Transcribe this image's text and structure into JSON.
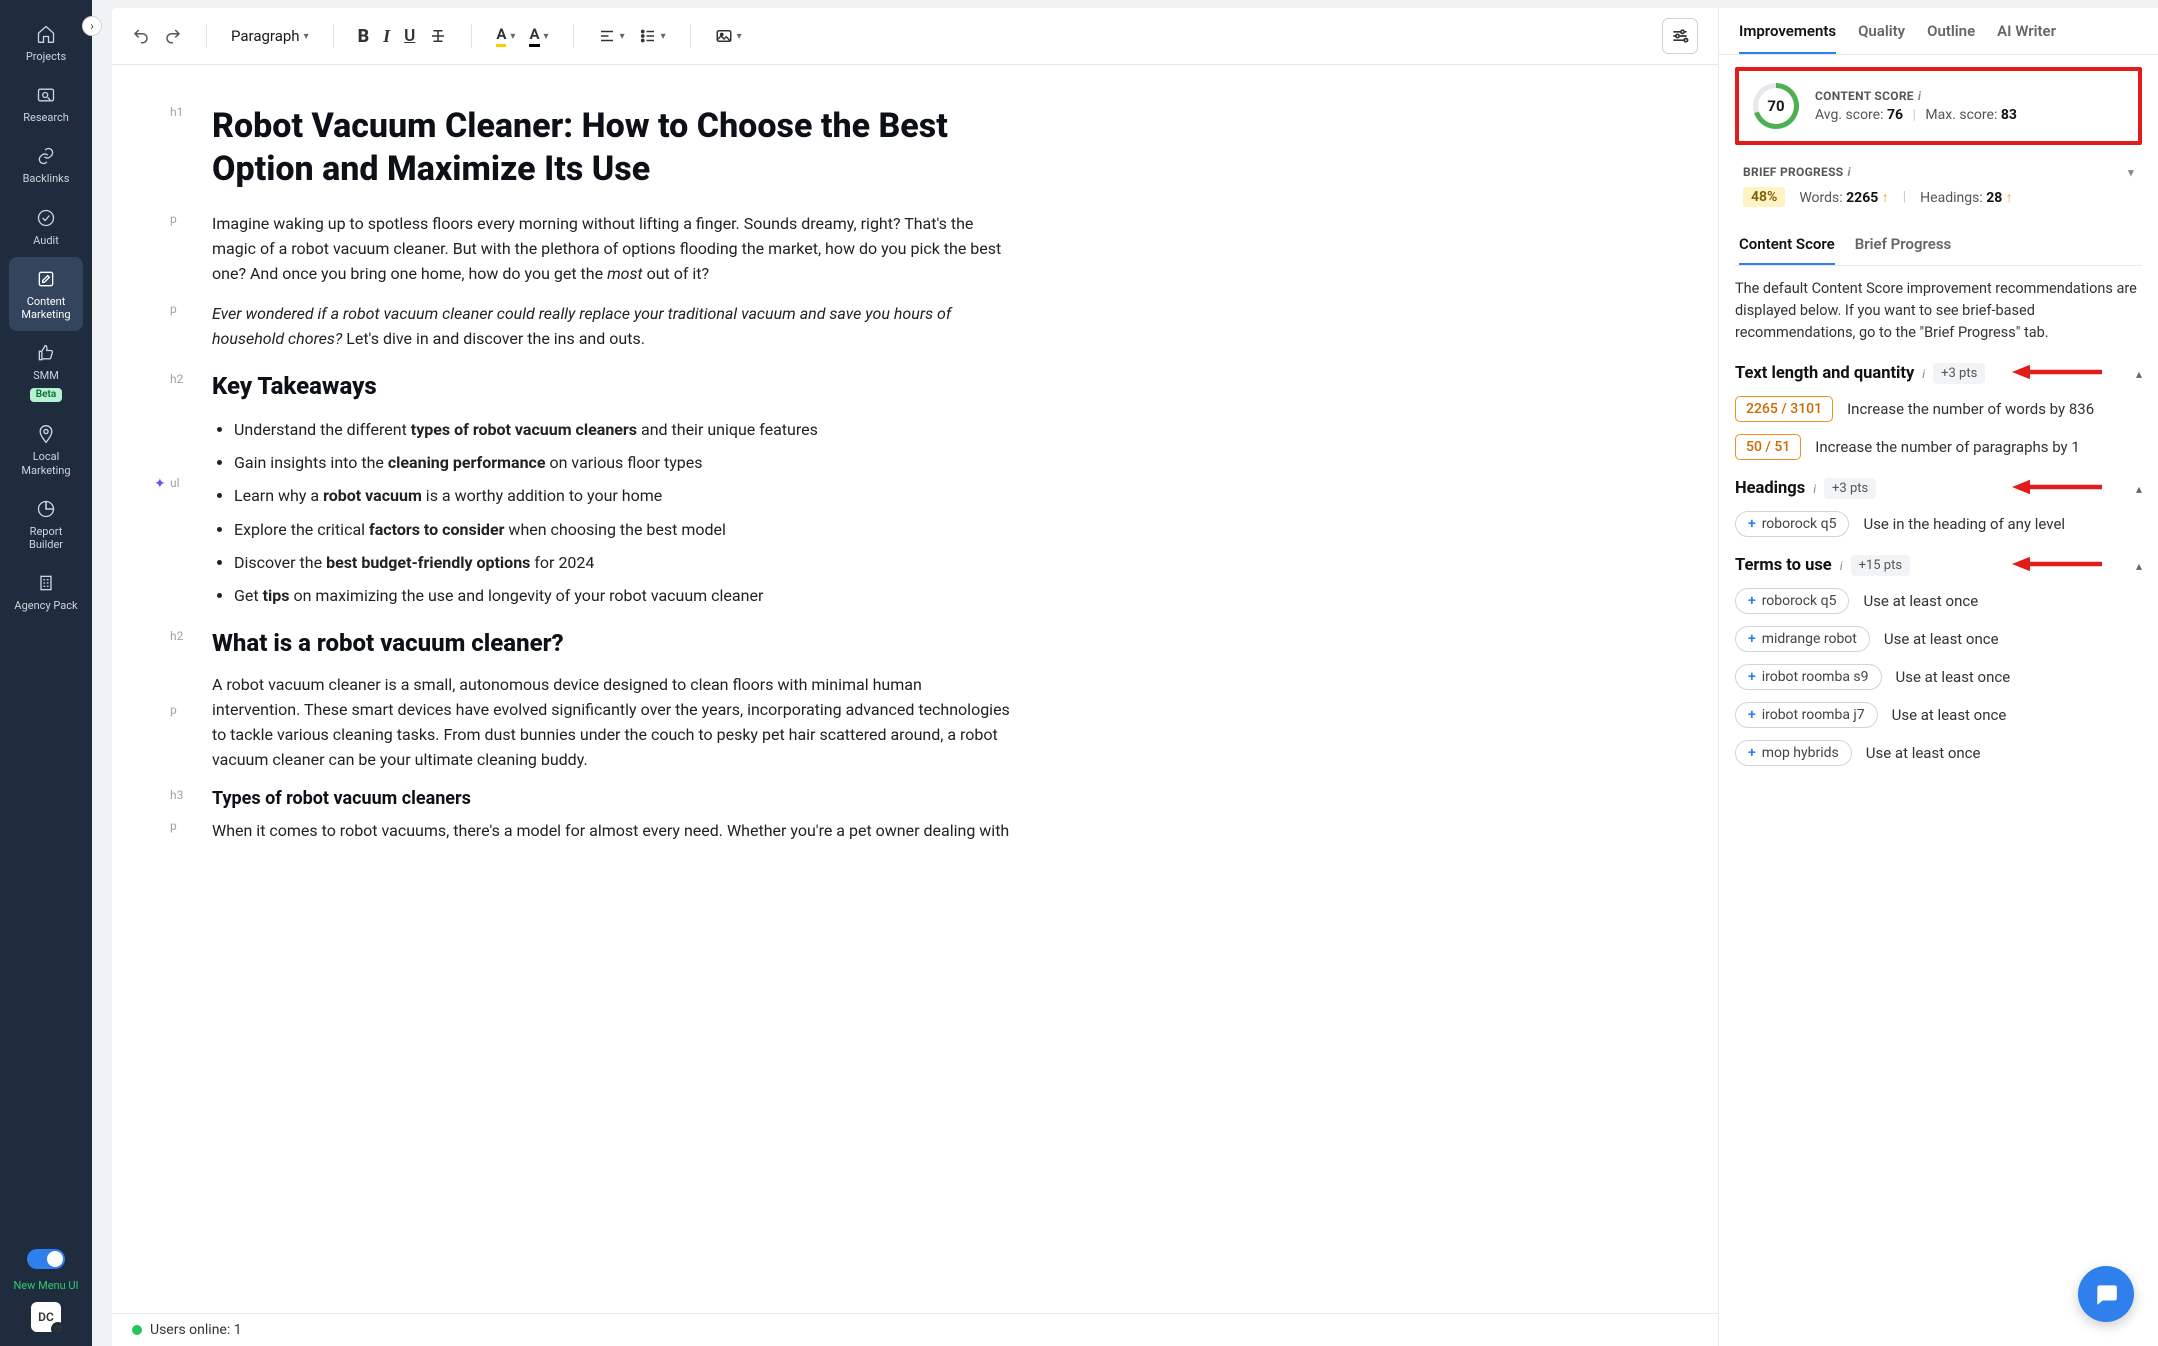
{
  "sidebar": {
    "items": [
      {
        "icon": "home",
        "label": "Projects"
      },
      {
        "icon": "search",
        "label": "Research"
      },
      {
        "icon": "link",
        "label": "Backlinks"
      },
      {
        "icon": "check",
        "label": "Audit"
      },
      {
        "icon": "edit",
        "label": "Content Marketing",
        "active": true
      },
      {
        "icon": "thumb",
        "label": "SMM",
        "badge": "Beta"
      },
      {
        "icon": "pin",
        "label": "Local Marketing"
      },
      {
        "icon": "pie",
        "label": "Report Builder"
      },
      {
        "icon": "building",
        "label": "Agency Pack"
      }
    ],
    "newmenu": "New Menu UI",
    "avatar": "DC"
  },
  "toolbar": {
    "style_dropdown": "Paragraph"
  },
  "document": {
    "h1": "Robot Vacuum Cleaner: How to Choose the Best Option and Maximize Its Use",
    "p1_a": "Imagine waking up to spotless floors every morning without lifting a finger. Sounds dreamy, right? That's the magic of a robot vacuum cleaner. But with the plethora of options flooding the market, how do you pick the best one? And once you bring one home, how do you get the ",
    "p1_b": "most",
    "p1_c": " out of it?",
    "p2_a": "Ever wondered if a robot vacuum cleaner could really replace your traditional vacuum and save you hours of household chores?",
    "p2_b": " Let's dive in and discover the ins and outs.",
    "h2_key": "Key Takeaways",
    "li1_a": "Understand the different ",
    "li1_b": "types of robot vacuum cleaners",
    "li1_c": " and their unique features",
    "li2_a": "Gain insights into the ",
    "li2_b": "cleaning performance",
    "li2_c": " on various floor types",
    "li3_a": "Learn why a ",
    "li3_b": "robot vacuum",
    "li3_c": " is a worthy addition to your home",
    "li4_a": "Explore the critical ",
    "li4_b": "factors to consider",
    "li4_c": " when choosing the best model",
    "li5_a": "Discover the ",
    "li5_b": "best budget-friendly options",
    "li5_c": " for 2024",
    "li6_a": "Get ",
    "li6_b": "tips",
    "li6_c": " on maximizing the use and longevity of your robot vacuum cleaner",
    "h2_what": "What is a robot vacuum cleaner?",
    "p3": "A robot vacuum cleaner is a small, autonomous device designed to clean floors with minimal human intervention. These smart devices have evolved significantly over the years, incorporating advanced technologies to tackle various cleaning tasks. From dust bunnies under the couch to pesky pet hair scattered around, a robot vacuum cleaner can be your ultimate cleaning buddy.",
    "h3_types": "Types of robot vacuum cleaners",
    "p4": "When it comes to robot vacuums, there's a model for almost every need. Whether you're a pet owner dealing with"
  },
  "status": {
    "online_label": "Users online: 1"
  },
  "right": {
    "tabs": [
      "Improvements",
      "Quality",
      "Outline",
      "AI Writer"
    ],
    "score": {
      "label": "CONTENT SCORE",
      "value": "70",
      "avg_label": "Avg. score: ",
      "avg": "76",
      "max_label": "Max. score: ",
      "max": "83"
    },
    "brief": {
      "label": "BRIEF PROGRESS",
      "pct": "48%",
      "words_label": "Words: ",
      "words": "2265",
      "headings_label": "Headings: ",
      "headings": "28"
    },
    "subtabs": [
      "Content Score",
      "Brief Progress"
    ],
    "desc": "The default Content Score improvement recommendations are displayed below. If you want to see brief-based recommendations, go to the \"Brief Progress\" tab.",
    "sec_textlen": {
      "title": "Text length and quantity",
      "pts": "+3 pts",
      "rec1_count": "2265 / 3101",
      "rec1_text": "Increase the number of words by 836",
      "rec2_count": "50 / 51",
      "rec2_text": "Increase the number of paragraphs by 1"
    },
    "sec_headings": {
      "title": "Headings",
      "pts": "+3 pts",
      "term": "roborock q5",
      "rec_text": "Use in the heading of any level"
    },
    "sec_terms": {
      "title": "Terms to use",
      "pts": "+15 pts",
      "items": [
        {
          "term": "roborock q5",
          "rec": "Use at least once"
        },
        {
          "term": "midrange robot",
          "rec": "Use at least once"
        },
        {
          "term": "irobot roomba s9",
          "rec": "Use at least once"
        },
        {
          "term": "irobot roomba j7",
          "rec": "Use at least once"
        },
        {
          "term": "mop hybrids",
          "rec": "Use at least once"
        }
      ]
    }
  }
}
